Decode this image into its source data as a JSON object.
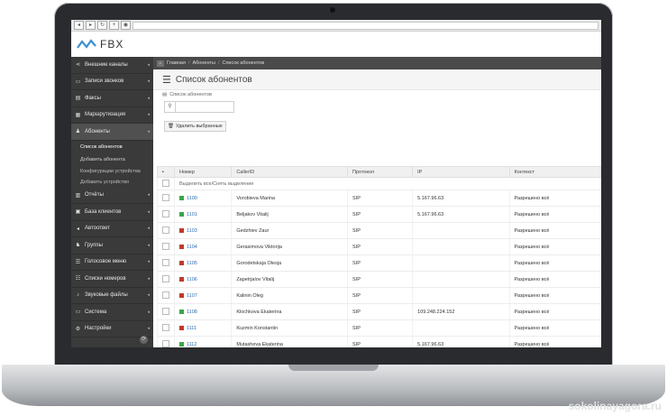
{
  "app": {
    "brand": "FBX",
    "watermark": "sokolinayagora.ru"
  },
  "sidebar": {
    "items": [
      {
        "label": "Внешние каналы",
        "icon": "share-icon",
        "glyph": "⋖"
      },
      {
        "label": "Записи звонков",
        "icon": "folder-icon",
        "glyph": "▭"
      },
      {
        "label": "Факсы",
        "icon": "fax-icon",
        "glyph": "▤"
      },
      {
        "label": "Маршрутизация",
        "icon": "routing-icon",
        "glyph": "▦"
      },
      {
        "label": "Абоненты",
        "icon": "users-icon",
        "glyph": "♟",
        "active": true
      }
    ],
    "submenu": [
      {
        "label": "Список абонентов",
        "active": true
      },
      {
        "label": "Добавить абонента"
      },
      {
        "label": "Конфигурации устройства"
      },
      {
        "label": "Добавить устройство"
      }
    ],
    "items2": [
      {
        "label": "Отчёты",
        "icon": "reports-icon",
        "glyph": "▥"
      },
      {
        "label": "База клиентов",
        "icon": "database-icon",
        "glyph": "▣"
      },
      {
        "label": "Автоответ",
        "icon": "autoreply-icon",
        "glyph": "◂"
      },
      {
        "label": "Группы",
        "icon": "groups-icon",
        "glyph": "♞"
      },
      {
        "label": "Голосовое меню",
        "icon": "voice-menu-icon",
        "glyph": "☰"
      },
      {
        "label": "Списки номеров",
        "icon": "number-list-icon",
        "glyph": "☷"
      },
      {
        "label": "Звуковые файлы",
        "icon": "mic-icon",
        "glyph": "♪"
      },
      {
        "label": "Система",
        "icon": "system-icon",
        "glyph": "▭"
      },
      {
        "label": "Настройки",
        "icon": "settings-icon",
        "glyph": "⚙"
      }
    ]
  },
  "breadcrumb": {
    "part1": "Главная",
    "part2": "Абоненты",
    "part3": "Список абонентов"
  },
  "page": {
    "title": "Список абонентов",
    "sublabel": "Список абонентов",
    "delete_label": "Удалить выбранные",
    "select_all": "Выделить все/Снять выделение"
  },
  "table": {
    "headers": [
      "Номер",
      "CallerID",
      "Протокол",
      "IP",
      "Контекст"
    ],
    "rows": [
      {
        "num": "1100",
        "callerid": "Vorobieva Marina",
        "proto": "SIP",
        "ip": "5.167.96.63",
        "ctx": "Разрешено всё",
        "status": "#3aa54a"
      },
      {
        "num": "1101",
        "callerid": "Beljakov Vitalij",
        "proto": "SIP",
        "ip": "5.167.96.63",
        "ctx": "Разрешено всё",
        "status": "#3aa54a"
      },
      {
        "num": "1103",
        "callerid": "Gedzhiev Zaur",
        "proto": "SIP",
        "ip": "",
        "ctx": "Разрешено всё",
        "status": "#c0392b"
      },
      {
        "num": "1104",
        "callerid": "Gerasimova Viktorija",
        "proto": "SIP",
        "ip": "",
        "ctx": "Разрешено всё",
        "status": "#c0392b"
      },
      {
        "num": "1105",
        "callerid": "Gorodetskaja Olesja",
        "proto": "SIP",
        "ip": "",
        "ctx": "Разрешено всё",
        "status": "#c0392b"
      },
      {
        "num": "1106",
        "callerid": "Zapetrjalov Vitalij",
        "proto": "SIP",
        "ip": "",
        "ctx": "Разрешено всё",
        "status": "#c0392b"
      },
      {
        "num": "1107",
        "callerid": "Kalinin Oleg",
        "proto": "SIP",
        "ip": "",
        "ctx": "Разрешено всё",
        "status": "#c0392b"
      },
      {
        "num": "1108",
        "callerid": "Klochkova Ekaterina",
        "proto": "SIP",
        "ip": "109.248.224.152",
        "ctx": "Разрешено всё",
        "status": "#3aa54a"
      },
      {
        "num": "1111",
        "callerid": "Kuzmin Konstantin",
        "proto": "SIP",
        "ip": "",
        "ctx": "Разрешено всё",
        "status": "#c0392b"
      },
      {
        "num": "1112",
        "callerid": "Mutasheva Ekaterina",
        "proto": "SIP",
        "ip": "5.167.96.63",
        "ctx": "Разрешено всё",
        "status": "#3aa54a"
      }
    ]
  }
}
